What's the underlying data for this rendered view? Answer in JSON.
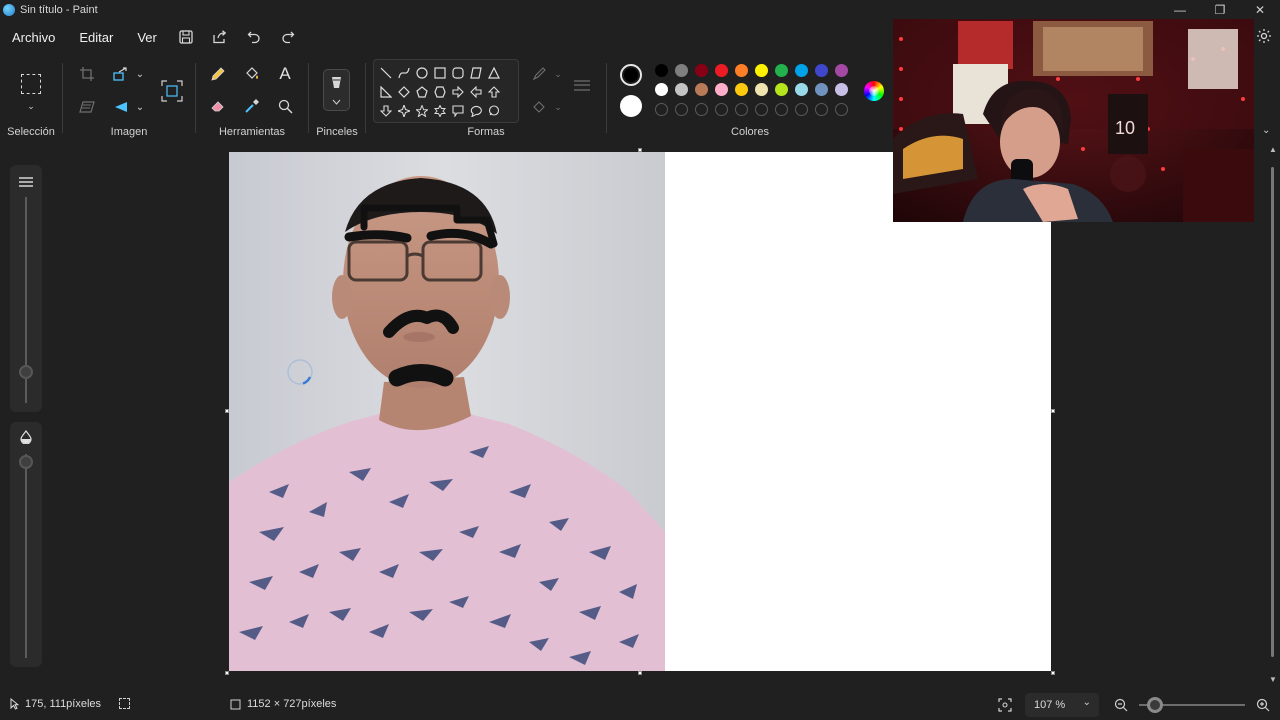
{
  "window": {
    "title": "Sin título - Paint",
    "controls": [
      "—",
      "❐",
      "✕"
    ]
  },
  "menu": {
    "file": "Archivo",
    "edit": "Editar",
    "view": "Ver"
  },
  "ribbon": {
    "selection_label": "Selección",
    "image_label": "Imagen",
    "tools_label": "Herramientas",
    "brushes_label": "Pinceles",
    "shapes_label": "Formas",
    "colors_label": "Colores"
  },
  "colors": {
    "primary": "#000000",
    "secondary": "#ffffff",
    "row1": [
      "#000000",
      "#7f7f7f",
      "#880015",
      "#ed1c24",
      "#ff7f27",
      "#fff200",
      "#22b14c",
      "#00a2e8",
      "#3f48cc",
      "#a349a4"
    ],
    "row2": [
      "#ffffff",
      "#c3c3c3",
      "#b97a57",
      "#ffaec9",
      "#ffc90e",
      "#efe4b0",
      "#b5e61d",
      "#99d9ea",
      "#7092be",
      "#c8bfe7"
    ]
  },
  "status": {
    "cursor_pos": "175, 111píxeles",
    "canvas_size": "1152 × 727píxeles",
    "zoom": "107 %"
  }
}
